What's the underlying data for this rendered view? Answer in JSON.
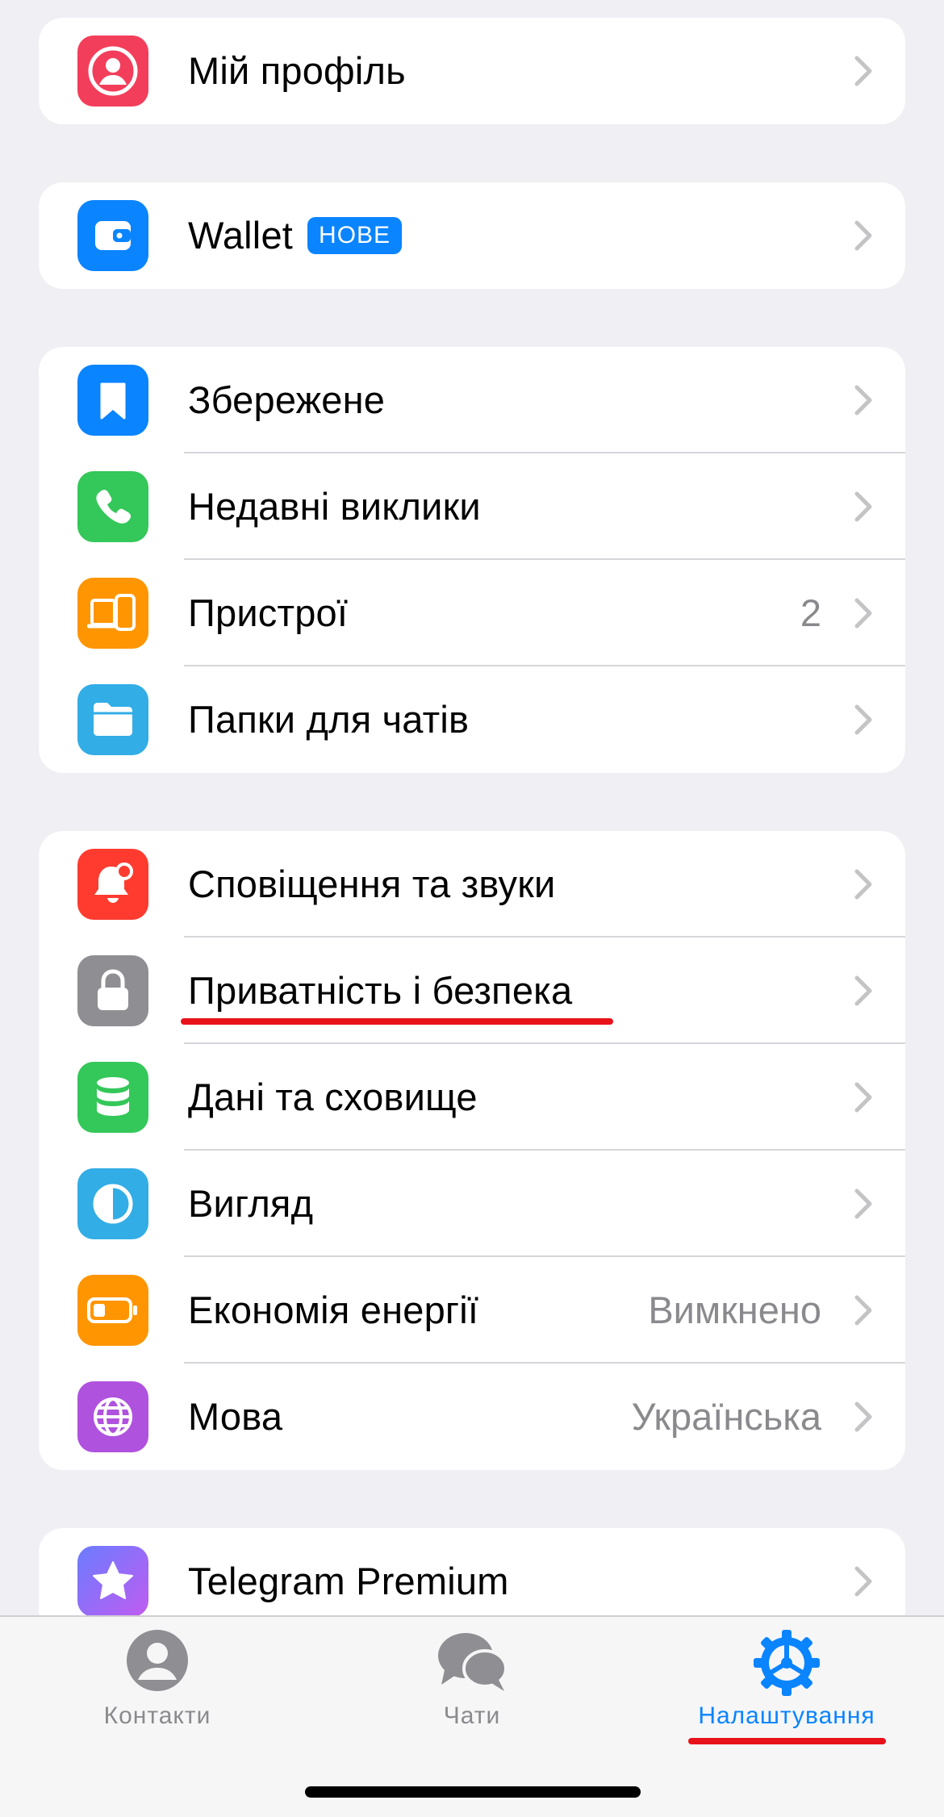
{
  "colors": {
    "background": "#efeff4",
    "accent": "#0a84ff",
    "annotation": "#e8121b"
  },
  "group1": {
    "profile": {
      "label": "Мій профіль",
      "icon": "person-icon"
    }
  },
  "group2": {
    "wallet": {
      "label": "Wallet",
      "badge": "НОВЕ",
      "icon": "wallet-icon"
    }
  },
  "group3": {
    "saved": {
      "label": "Збережене",
      "icon": "bookmark-icon"
    },
    "calls": {
      "label": "Недавні виклики",
      "icon": "phone-icon"
    },
    "devices": {
      "label": "Пристрої",
      "value": "2",
      "icon": "devices-icon"
    },
    "folders": {
      "label": "Папки для чатів",
      "icon": "folder-icon"
    }
  },
  "group4": {
    "notifications": {
      "label": "Сповіщення та звуки",
      "icon": "bell-icon"
    },
    "privacy": {
      "label": "Приватність і безпека",
      "icon": "lock-icon"
    },
    "data": {
      "label": "Дані та сховище",
      "icon": "database-icon"
    },
    "appearance": {
      "label": "Вигляд",
      "icon": "contrast-icon"
    },
    "power": {
      "label": "Економія енергії",
      "value": "Вимкнено",
      "icon": "battery-icon"
    },
    "language": {
      "label": "Мова",
      "value": "Українська",
      "icon": "globe-icon"
    }
  },
  "group5": {
    "premium": {
      "label": "Telegram Premium",
      "icon": "star-icon"
    }
  },
  "tabbar": {
    "contacts": "Контакти",
    "chats": "Чати",
    "settings": "Налаштування",
    "active": "settings"
  }
}
